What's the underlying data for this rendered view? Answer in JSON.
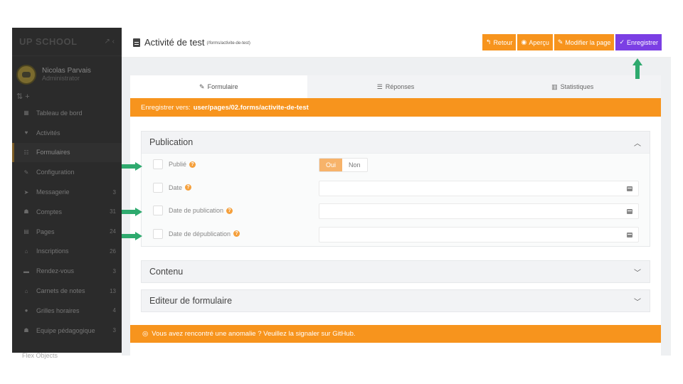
{
  "sidebar": {
    "logo": "UP SCHOOL",
    "user": {
      "name": "Nicolas Parvais",
      "role": "Administrator"
    },
    "tools": "⇅  +",
    "items": [
      {
        "icon": "▦",
        "label": "Tableau de bord",
        "badge": ""
      },
      {
        "icon": "♥",
        "label": "Activités",
        "badge": ""
      },
      {
        "icon": "☷",
        "label": "Formulaires",
        "badge": ""
      },
      {
        "icon": "✎",
        "label": "Configuration",
        "badge": ""
      },
      {
        "icon": "➤",
        "label": "Messagerie",
        "badge": "3"
      },
      {
        "icon": "☗",
        "label": "Comptes",
        "badge": "31"
      },
      {
        "icon": "▤",
        "label": "Pages",
        "badge": "24"
      },
      {
        "icon": "⌂",
        "label": "Inscriptions",
        "badge": "26"
      },
      {
        "icon": "▬",
        "label": "Rendez-vous",
        "badge": "3"
      },
      {
        "icon": "⌂",
        "label": "Carnets de notes",
        "badge": "13"
      },
      {
        "icon": "●",
        "label": "Grilles horaires",
        "badge": "4"
      },
      {
        "icon": "☗",
        "label": "Equipe pédagogique",
        "badge": "3"
      }
    ],
    "overflow_item": "Flex Objects"
  },
  "header": {
    "title": "Activité de test",
    "route": "(/forms/activite-de-test)",
    "buttons": {
      "back": "Retour",
      "preview": "Aperçu",
      "edit": "Modifier la page",
      "save": "Enregistrer"
    }
  },
  "tabs": [
    {
      "icon": "✎",
      "label": "Formulaire"
    },
    {
      "icon": "☰",
      "label": "Réponses"
    },
    {
      "icon": "▥",
      "label": "Statistiques"
    }
  ],
  "save_bar": {
    "prefix": "Enregistrer vers:",
    "path": "user/pages/02.forms/activite-de-test"
  },
  "sections": {
    "publication": {
      "title": "Publication",
      "fields": {
        "published": {
          "label": "Publié",
          "on": "Oui",
          "off": "Non"
        },
        "date": {
          "label": "Date"
        },
        "publish_date": {
          "label": "Date de publication"
        },
        "unpublish_date": {
          "label": "Date de dépublication"
        }
      }
    },
    "content": {
      "title": "Contenu"
    },
    "form_editor": {
      "title": "Editeur de formulaire"
    }
  },
  "footer": {
    "text": "Vous avez rencontré une anomalie ? Veuillez la signaler sur GitHub."
  },
  "colors": {
    "accent_orange": "#f7941d",
    "save_purple": "#7b3fe4",
    "annotation_green": "#2eaa6e"
  }
}
